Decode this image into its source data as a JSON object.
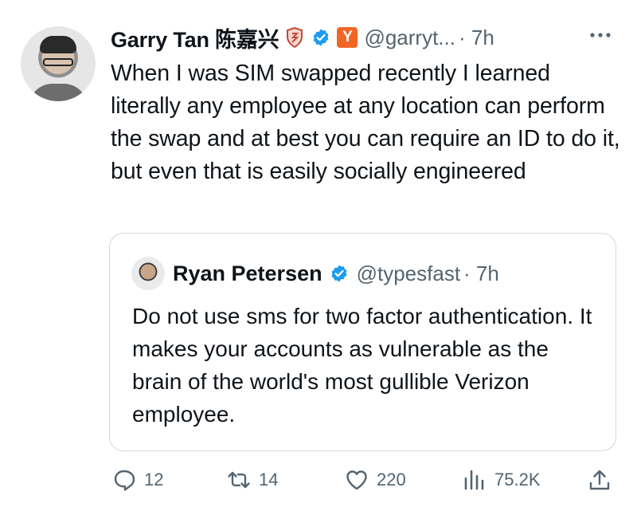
{
  "tweet": {
    "author_name": "Garry Tan 陈嘉兴",
    "company_badge": "Y",
    "handle": "@garryt...",
    "time": "· 7h",
    "text": "When I was SIM swapped recently I learned literally any employee at any location can perform the swap and at best you can require an ID to do it, but even that is easily socially engineered"
  },
  "quote": {
    "author_name": "Ryan Petersen",
    "handle": "@typesfast",
    "time": "· 7h",
    "text": "Do not use sms for two factor authentication. It makes your accounts as vulnerable as the brain of the world's most gullible Verizon employee."
  },
  "actions": {
    "replies": "12",
    "reposts": "14",
    "likes": "220",
    "views": "75.2K"
  },
  "colors": {
    "verified_blue": "#1d9bf0",
    "yc_orange": "#f26625",
    "muted_text": "#536471",
    "border": "#cfd9de"
  },
  "icons": [
    "more-icon",
    "verified-icon",
    "shield-badge-icon",
    "reply-icon",
    "repost-icon",
    "like-icon",
    "views-icon",
    "share-icon"
  ]
}
